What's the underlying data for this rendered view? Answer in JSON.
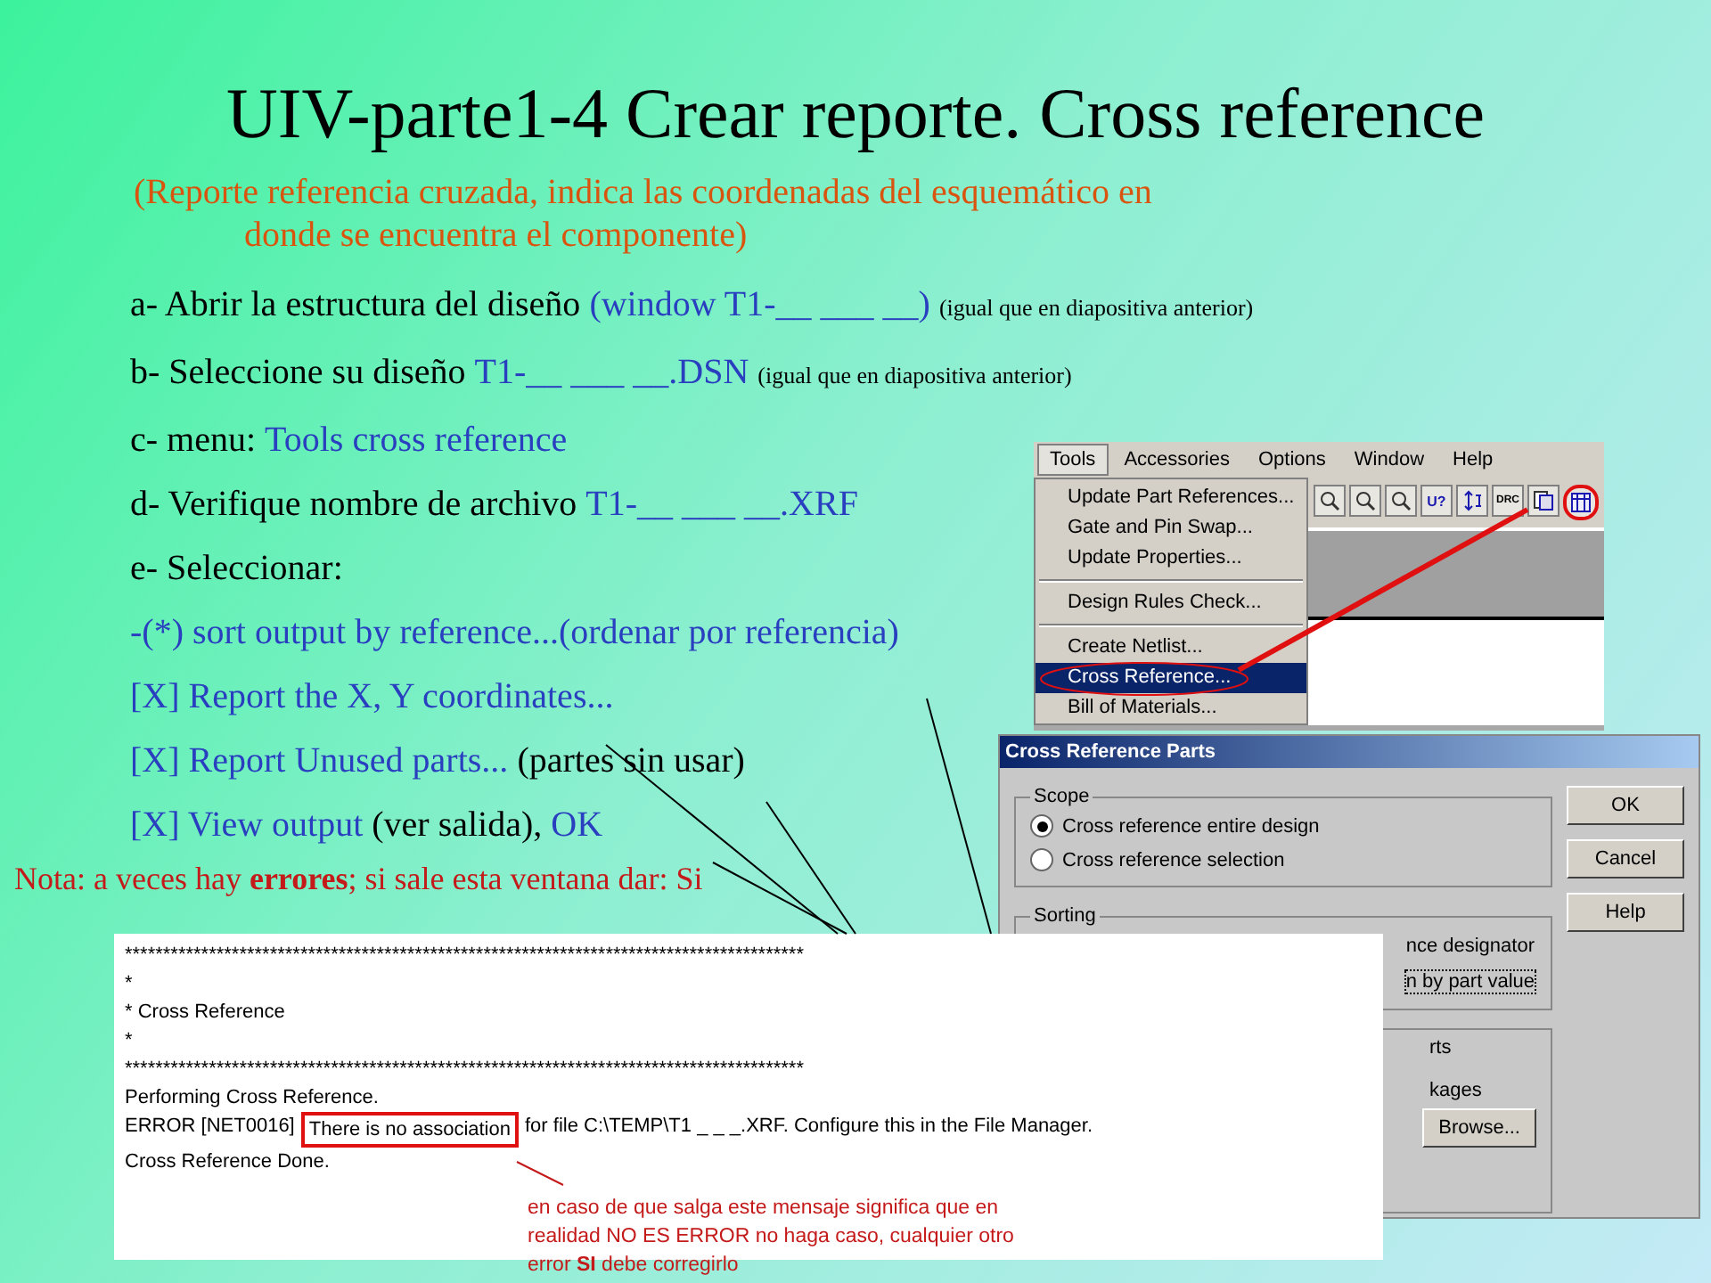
{
  "title": "UIV-parte1-4 Crear reporte. Cross reference",
  "subtitle": {
    "lines": [
      "(Reporte referencia cruzada, indica las coordenadas del esquemático en",
      "donde se encuentra el componente)"
    ]
  },
  "steps": [
    {
      "parts": [
        {
          "kind": "plain",
          "text": "a- Abrir la estructura del diseño "
        },
        {
          "kind": "blue",
          "text": "(window T1-__ ___ __)"
        },
        {
          "kind": "small",
          "text": "(igual que en diapositiva anterior)"
        }
      ]
    },
    {
      "parts": [
        {
          "kind": "plain",
          "text": "b- Seleccione su diseño "
        },
        {
          "kind": "blue",
          "text": "T1-__ ___ __.DSN"
        },
        {
          "kind": "small",
          "text": "(igual que en diapositiva anterior)"
        }
      ]
    },
    {
      "parts": [
        {
          "kind": "plain",
          "text": "c- menu: "
        },
        {
          "kind": "blue",
          "text": "Tools cross reference"
        }
      ]
    },
    {
      "parts": [
        {
          "kind": "plain",
          "text": "d- Verifique nombre de archivo "
        },
        {
          "kind": "blue",
          "text": "T1-__ ___ __.XRF"
        }
      ]
    },
    {
      "parts": [
        {
          "kind": "plain",
          "text": "e- Seleccionar:"
        }
      ]
    },
    {
      "parts": [
        {
          "kind": "blue",
          "text": "-(*) sort output by reference...(ordenar por referencia)"
        }
      ]
    },
    {
      "parts": [
        {
          "kind": "blue",
          "text": "[X] Report the X, Y coordinates..."
        }
      ]
    },
    {
      "parts": [
        {
          "kind": "blue",
          "text": "[X] Report Unused parts..."
        },
        {
          "kind": "plain",
          "text": "(partes sin usar)"
        }
      ]
    },
    {
      "parts": [
        {
          "kind": "blue",
          "text": "[X] View output"
        },
        {
          "kind": "plain",
          "text": "(ver salida),"
        },
        {
          "kind": "blue",
          "text": "OK"
        }
      ]
    }
  ],
  "note": "Nota: a veces hay **errores**; si sale esta ventana dar: Si",
  "menu_screenshot": {
    "menubar": [
      {
        "label": "Tools",
        "selected": true
      },
      {
        "label": "Accessories",
        "selected": false
      },
      {
        "label": "Options",
        "selected": false
      },
      {
        "label": "Window",
        "selected": false
      },
      {
        "label": "Help",
        "selected": false
      }
    ],
    "items": [
      {
        "kind": "item",
        "label": "Update Part References...",
        "selected": false
      },
      {
        "kind": "item",
        "label": "Gate and Pin Swap...",
        "selected": false
      },
      {
        "kind": "item",
        "label": "Update Properties...",
        "selected": false
      },
      {
        "kind": "separator"
      },
      {
        "kind": "item",
        "label": "Design Rules Check...",
        "selected": false
      },
      {
        "kind": "separator"
      },
      {
        "kind": "item",
        "label": "Create Netlist...",
        "selected": false
      },
      {
        "kind": "item",
        "label": "Cross Reference...",
        "selected": true
      },
      {
        "kind": "item",
        "label": "Bill of Materials...",
        "selected": false
      }
    ],
    "toolbar": [
      {
        "kind": "zoom",
        "highlighted": false
      },
      {
        "kind": "zoom",
        "highlighted": false
      },
      {
        "kind": "zoom",
        "highlighted": false
      },
      {
        "kind": "text",
        "text": "U?",
        "highlighted": false
      },
      {
        "kind": "swap",
        "highlighted": false
      },
      {
        "kind": "drc",
        "text": "DRC",
        "highlighted": false
      },
      {
        "kind": "netlist",
        "highlighted": false
      },
      {
        "kind": "xref",
        "highlighted": true
      }
    ]
  },
  "dialog": {
    "title": "Cross Reference Parts",
    "scope": {
      "label": "Scope",
      "options": [
        {
          "label": "Cross reference entire design",
          "selected": true
        },
        {
          "label": "Cross reference selection",
          "selected": false
        }
      ]
    },
    "sorting": {
      "label": "Sorting",
      "fragments": [
        {
          "text": "nce designator",
          "focused": false
        },
        {
          "text": "n by part value",
          "focused": true
        }
      ]
    },
    "report_fragments": [
      "rts",
      "kages"
    ],
    "browse": "Browse...",
    "buttons": [
      "OK",
      "Cancel",
      "Help"
    ]
  },
  "output": {
    "lines": [
      {
        "kind": "text",
        "text": "*****************************************************************************************"
      },
      {
        "kind": "text",
        "text": "*"
      },
      {
        "kind": "text",
        "text": "*  Cross Reference"
      },
      {
        "kind": "text",
        "text": "*"
      },
      {
        "kind": "text",
        "text": "*****************************************************************************************"
      },
      {
        "kind": "text",
        "text": "Performing Cross Reference."
      },
      {
        "kind": "error",
        "code": "ERROR [NET0016]",
        "boxed": "There is no association",
        "rest": "for file C:\\TEMP\\T1 _ _ _.XRF. Configure this in the File Manager."
      },
      {
        "kind": "text",
        "text": "Cross Reference Done."
      }
    ],
    "annotation": [
      "en caso de que salga este mensaje significa que en",
      "realidad NO ES ERROR no haga caso, cualquier otro",
      "error **SI** debe corregirlo"
    ]
  }
}
